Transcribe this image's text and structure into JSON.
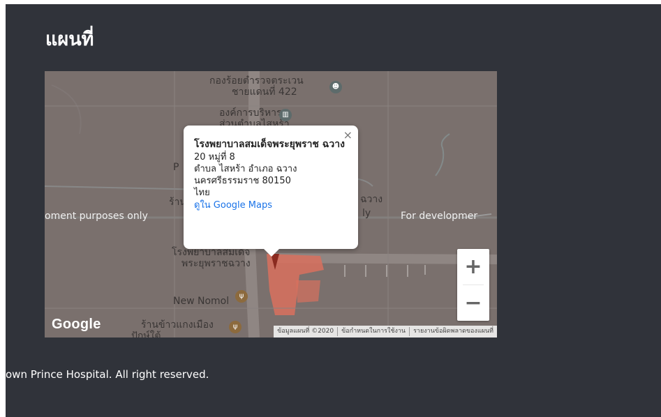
{
  "section": {
    "title": "แผนที่"
  },
  "map": {
    "pois": [
      {
        "line1": "กองร้อยตำรวจตระเวน",
        "line2": "ชายแดนที่ 422"
      },
      {
        "line1": "องค์การบริหาร",
        "line2": "ส่วนตำบลไสหร้า"
      },
      {
        "line1": "New Nomol"
      },
      {
        "line1": "ร้านข้าวแกงเมือง",
        "line2": "ปักษ์ใต้"
      },
      {
        "line1": "โรงพยาบาลสมเด็จ",
        "line2": "พระยุพราชฉวาง"
      }
    ],
    "partial_labels": {
      "left_p": "P",
      "left_ran": "ร้าน",
      "right_chawang": "ฉวาง",
      "right_ly": "ly"
    },
    "watermark": {
      "left": "oment purposes only",
      "right": "For developmer"
    },
    "logo": "Google",
    "attribution": [
      "ข้อมูลแผนที่ ©2020",
      "ข้อกำหนดในการใช้งาน",
      "รายงานข้อผิดพลาดของแผนที่"
    ],
    "zoom": {
      "in": "+",
      "out": "−"
    },
    "popup": {
      "close": "×",
      "name": "โรงพยาบาลสมเด็จพระยุพราช ฉวาง",
      "lines": [
        "20 หมู่ที่ 8",
        "ตำบล ไสหร้า อำเภอ ฉวาง",
        "นครศรีธรรมราช 80150",
        "ไทย"
      ],
      "link": "ดูใน Google Maps"
    }
  },
  "footer": {
    "text": "own Prince Hospital. All right reserved."
  },
  "colors": {
    "panel": "#30333a",
    "map_tint": "#7a706d",
    "hospital": "#d9705e",
    "link": "#1a73e8"
  }
}
